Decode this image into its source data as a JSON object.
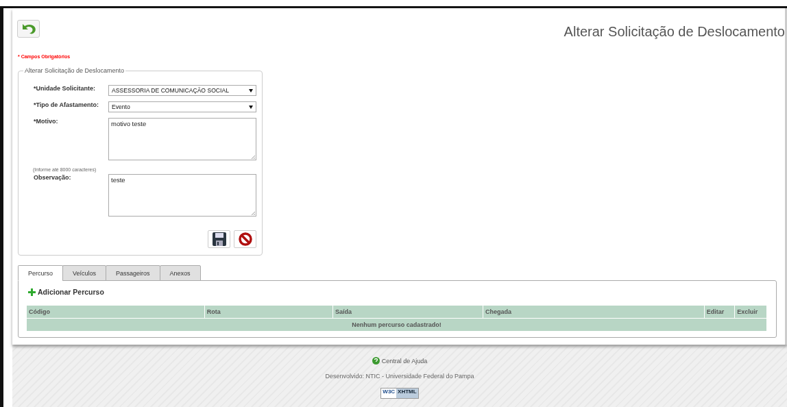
{
  "page": {
    "title": "Alterar Solicitação de Deslocamento",
    "required_note": "* Campos Obrigatórios"
  },
  "form": {
    "legend": "Alterar Solicitação de Deslocamento",
    "fields": [
      {
        "kind": "select",
        "label": "*Unidade Solicitante:",
        "value": "ASSESSORIA DE COMUNICAÇÃO SOCIAL"
      },
      {
        "kind": "select",
        "label": "*Tipo de Afastamento:",
        "value": "Evento"
      },
      {
        "kind": "textarea",
        "label": "*Motivo:",
        "value": "motivo teste"
      },
      {
        "kind": "textarea",
        "label": "Observação:",
        "hint": "(Informe até 8000 caracteres)",
        "value": "teste"
      }
    ]
  },
  "tabs": [
    {
      "label": "Percurso",
      "selected": true
    },
    {
      "label": "Veículos",
      "selected": false
    },
    {
      "label": "Passageiros",
      "selected": false
    },
    {
      "label": "Anexos",
      "selected": false
    }
  ],
  "add_link": "Adicionar Percurso",
  "table": {
    "columns": [
      "Código",
      "Rota",
      "Saída",
      "Chegada",
      "Editar",
      "Excluir"
    ],
    "empty_message": "Nenhum percurso cadastrado!"
  },
  "footer": {
    "help_link": "Central de Ajuda",
    "credits": "Desenvolvido: NTIC - Universidade Federal do Pampa",
    "badge_left": "W3C",
    "badge_right": "XHTML"
  }
}
